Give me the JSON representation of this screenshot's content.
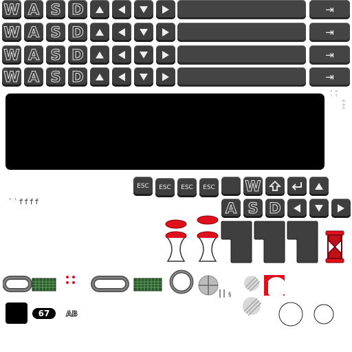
{
  "rows": [
    {
      "keys": [
        "W",
        "A",
        "S",
        "D"
      ],
      "arrows": [
        "arrow-up",
        "arrow-left",
        "arrow-down",
        "arrow-right"
      ],
      "tab_label": "⇥"
    },
    {
      "keys": [
        "W",
        "A",
        "S",
        "D"
      ],
      "arrows": [
        "arrow-up",
        "arrow-left",
        "arrow-down",
        "arrow-right"
      ],
      "tab_label": "⇥"
    },
    {
      "keys": [
        "W",
        "A",
        "S",
        "D"
      ],
      "arrows": [
        "arrow-up",
        "arrow-left",
        "arrow-down",
        "arrow-right"
      ],
      "tab_label": "⇥"
    },
    {
      "keys": [
        "W",
        "A",
        "S",
        "D"
      ],
      "arrows": [
        "arrow-up",
        "arrow-left",
        "arrow-down",
        "arrow-right"
      ],
      "tab_label": "⇥"
    }
  ],
  "esc_keys": [
    "ESC",
    "ESC",
    "ESC",
    "ESC"
  ],
  "keypad": {
    "top": [
      "",
      "W",
      "shift-icon",
      "enter-icon",
      "arrow-up"
    ],
    "bottom": [
      "A",
      "S",
      "D",
      "arrow-left",
      "arrow-down",
      "arrow-right"
    ]
  },
  "notes_text": "``ffff",
  "counter": "67",
  "ab_text": "AB",
  "colors": {
    "key": "#3f3f3f",
    "screen": "#000000",
    "bar": "#444444",
    "red": "#e0101c",
    "grid_green": "#2d5a2d"
  }
}
